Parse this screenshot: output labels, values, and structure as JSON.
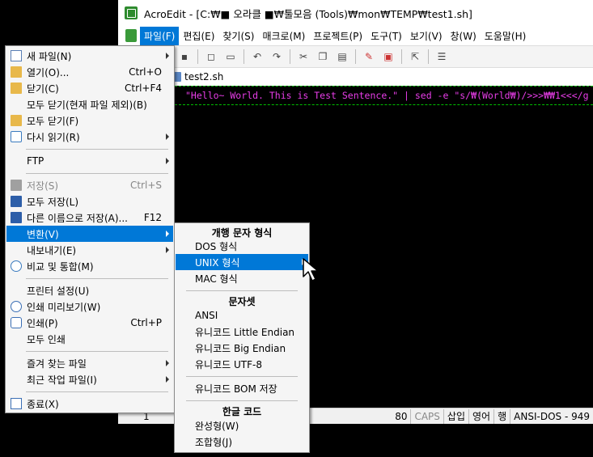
{
  "window": {
    "title": "AcroEdit - [C:₩■ 오라클 ■₩툴모음 (Tools)₩mon₩TEMP₩test1.sh]"
  },
  "menubar": {
    "items": [
      "파일(F)",
      "편집(E)",
      "찾기(S)",
      "매크로(M)",
      "프로젝트(P)",
      "도구(T)",
      "보기(V)",
      "창(W)",
      "도움말(H)"
    ]
  },
  "tab": {
    "label": "test2.sh"
  },
  "editor": {
    "code": "\"Hello~ World. This is Test Sentence.\" | sed -e \"s/₩(World₩)/>>>₩₩1<<</g"
  },
  "statusbar": {
    "line": "1",
    "col": "80",
    "caps": "CAPS",
    "insert": "삽입",
    "lang": "영어",
    "row": "행",
    "encoding": "ANSI-DOS - 949"
  },
  "file_menu": {
    "new": "새 파일(N)",
    "open": "열기(O)...",
    "open_sc": "Ctrl+O",
    "close": "닫기(C)",
    "close_sc": "Ctrl+F4",
    "close_all_except": "모두 닫기(현재 파일 제외)(B)",
    "close_all": "모두 닫기(F)",
    "reload": "다시 읽기(R)",
    "ftp": "FTP",
    "save": "저장(S)",
    "save_sc": "Ctrl+S",
    "save_all": "모두 저장(L)",
    "save_as": "다른 이름으로 저장(A)...",
    "save_as_sc": "F12",
    "convert": "변환(V)",
    "export": "내보내기(E)",
    "compare": "비교 및 통합(M)",
    "printer_setup": "프린터 설정(U)",
    "print_preview": "인쇄 미리보기(W)",
    "print": "인쇄(P)",
    "print_sc": "Ctrl+P",
    "print_all": "모두 인쇄",
    "favorites": "즐겨 찾는 파일",
    "recent": "최근 작업 파일(I)",
    "exit": "종료(X)"
  },
  "convert_menu": {
    "newline_header": "개행 문자 형식",
    "dos": "DOS 형식",
    "unix": "UNIX 형식",
    "mac": "MAC 형식",
    "charset_header": "문자셋",
    "ansi": "ANSI",
    "utf16le": "유니코드 Little Endian",
    "utf16be": "유니코드 Big Endian",
    "utf8": "유니코드 UTF-8",
    "bom": "유니코드 BOM 저장",
    "hangul_header": "한글 코드",
    "wansung": "완성형(W)",
    "johab": "조합형(J)"
  }
}
